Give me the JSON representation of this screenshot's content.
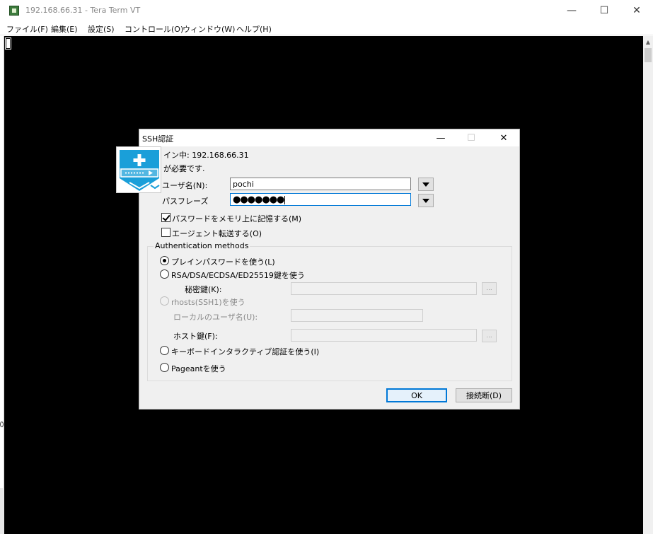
{
  "window": {
    "title": "192.168.66.31 - Tera Term VT",
    "minimize": "—",
    "maximize": "☐",
    "close": "✕"
  },
  "menu": [
    "ファイル(F)",
    "編集(E)",
    "設定(S)",
    "コントロール(O)",
    "ウィンドウ(W)",
    "ヘルプ(H)"
  ],
  "dialog": {
    "title": "SSH認証",
    "minimize": "—",
    "maximize": "☐",
    "close": "✕",
    "login_status": "イン中: 192.168.66.31",
    "auth_required": "が必要です.",
    "username_label": "ユーザ名(N):",
    "username_value": "pochi",
    "passphrase_label": "パスフレーズ",
    "passphrase_value": "●●●●●●●",
    "remember_password_label": "パスワードをメモリ上に記憶する(M)",
    "remember_password_checked": true,
    "agent_forward_label": "エージェント転送する(O)",
    "agent_forward_checked": false,
    "group_title": "Authentication methods",
    "method_plain": "プレインパスワードを使う(L)",
    "method_rsa": "RSA/DSA/ECDSA/ED25519鍵を使う",
    "private_key_label": "秘密鍵(K):",
    "method_rhosts": "rhosts(SSH1)を使う",
    "local_user_label": "ローカルのユーザ名(U):",
    "host_key_label": "ホスト鍵(F):",
    "method_keyboard": "キーボードインタラクティブ認証を使う(I)",
    "method_pageant": "Pageantを使う",
    "browse_label": "...",
    "selected_method": "plain",
    "ok_label": "OK",
    "disconnect_label": "接続断(D)"
  },
  "colors": {
    "terminal_bg": "#000000",
    "logo_blue": "#1a9fd9",
    "focus": "#0078d7"
  },
  "icons": {
    "app": "tera-term-icon",
    "logo": "ssh-shield-icon",
    "dropdown": "triangle-down-icon"
  }
}
